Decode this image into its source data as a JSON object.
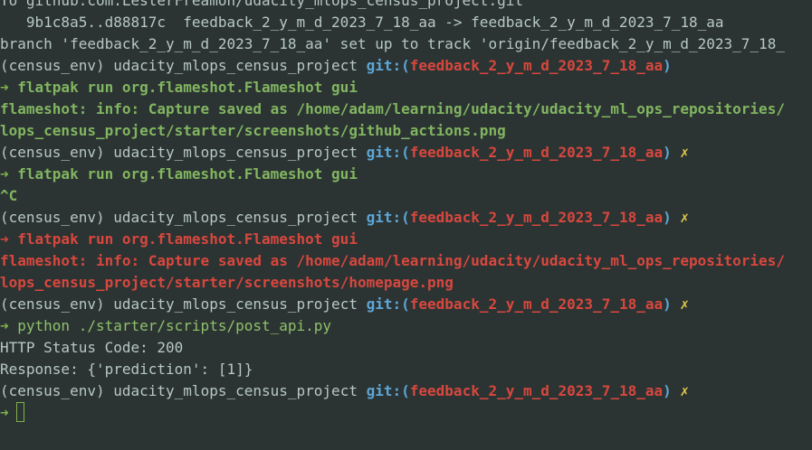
{
  "terminal": {
    "lines": [
      {
        "segments": [
          {
            "cls": "plain",
            "text": "To github.com:LesterFreamon/udacity_mlops_census_project.git"
          }
        ]
      },
      {
        "segments": [
          {
            "cls": "plain",
            "text": "   9b1c8a5..d88817c  feedback_2_y_m_d_2023_7_18_aa -> feedback_2_y_m_d_2023_7_18_aa"
          }
        ]
      },
      {
        "segments": [
          {
            "cls": "plain",
            "text": "branch 'feedback_2_y_m_d_2023_7_18_aa' set up to track 'origin/feedback_2_y_m_d_2023_7_18_"
          }
        ]
      },
      {
        "segments": [
          {
            "cls": "env",
            "text": "(census_env) "
          },
          {
            "cls": "dir",
            "text": "udacity_mlops_census_project "
          },
          {
            "cls": "git",
            "text": "git:("
          },
          {
            "cls": "br",
            "text": "feedback_2_y_m_d_2023_7_18_aa"
          },
          {
            "cls": "git",
            "text": ")"
          }
        ]
      },
      {
        "segments": [
          {
            "cls": "arrow-ok",
            "text": "➜ "
          },
          {
            "cls": "cmd-b",
            "text": "flatpak run org.flameshot.Flameshot gui"
          }
        ]
      },
      {
        "segments": [
          {
            "cls": "out-b",
            "text": "flameshot: info: Capture saved as /home/adam/learning/udacity/udacity_ml_ops_repositories/"
          }
        ]
      },
      {
        "segments": [
          {
            "cls": "out-b",
            "text": "lops_census_project/starter/screenshots/github_actions.png"
          }
        ]
      },
      {
        "segments": [
          {
            "cls": "env",
            "text": "(census_env) "
          },
          {
            "cls": "dir",
            "text": "udacity_mlops_census_project "
          },
          {
            "cls": "git",
            "text": "git:("
          },
          {
            "cls": "br",
            "text": "feedback_2_y_m_d_2023_7_18_aa"
          },
          {
            "cls": "git",
            "text": ") "
          },
          {
            "cls": "dirty",
            "text": "✗"
          }
        ]
      },
      {
        "segments": [
          {
            "cls": "arrow-ok",
            "text": "➜ "
          },
          {
            "cls": "cmd-b",
            "text": "flatpak run org.flameshot.Flameshot gui"
          }
        ]
      },
      {
        "segments": [
          {
            "cls": "out-b",
            "text": "^C"
          }
        ]
      },
      {
        "segments": [
          {
            "cls": "env",
            "text": "(census_env) "
          },
          {
            "cls": "dir",
            "text": "udacity_mlops_census_project "
          },
          {
            "cls": "git",
            "text": "git:("
          },
          {
            "cls": "br",
            "text": "feedback_2_y_m_d_2023_7_18_aa"
          },
          {
            "cls": "git",
            "text": ") "
          },
          {
            "cls": "dirty",
            "text": "✗"
          }
        ]
      },
      {
        "segments": [
          {
            "cls": "arrow-err",
            "text": "➜ "
          },
          {
            "cls": "err-b",
            "text": "flatpak run org.flameshot.Flameshot gui"
          }
        ]
      },
      {
        "segments": [
          {
            "cls": "err-b",
            "text": "flameshot: info: Capture saved as /home/adam/learning/udacity/udacity_ml_ops_repositories/"
          }
        ]
      },
      {
        "segments": [
          {
            "cls": "err-b",
            "text": "lops_census_project/starter/screenshots/homepage.png"
          }
        ]
      },
      {
        "segments": [
          {
            "cls": "env",
            "text": "(census_env) "
          },
          {
            "cls": "dir",
            "text": "udacity_mlops_census_project "
          },
          {
            "cls": "git",
            "text": "git:("
          },
          {
            "cls": "br",
            "text": "feedback_2_y_m_d_2023_7_18_aa"
          },
          {
            "cls": "git",
            "text": ") "
          },
          {
            "cls": "dirty",
            "text": "✗"
          }
        ]
      },
      {
        "segments": [
          {
            "cls": "arrow-ok",
            "text": "➜ "
          },
          {
            "cls": "cmd",
            "text": "python ./starter/scripts/post_api.py"
          }
        ]
      },
      {
        "segments": [
          {
            "cls": "plain",
            "text": "HTTP Status Code: 200"
          }
        ]
      },
      {
        "segments": [
          {
            "cls": "plain",
            "text": "Response: {'prediction': [1]}"
          }
        ]
      },
      {
        "segments": [
          {
            "cls": "env",
            "text": "(census_env) "
          },
          {
            "cls": "dir",
            "text": "udacity_mlops_census_project "
          },
          {
            "cls": "git",
            "text": "git:("
          },
          {
            "cls": "br",
            "text": "feedback_2_y_m_d_2023_7_18_aa"
          },
          {
            "cls": "git",
            "text": ") "
          },
          {
            "cls": "dirty",
            "text": "✗"
          }
        ]
      },
      {
        "segments": [
          {
            "cls": "arrow-ok",
            "text": "➜ "
          }
        ]
      }
    ]
  },
  "colors": {
    "background": "#2b3433",
    "git_label": "#5ea6d6",
    "branch": "#d8473e",
    "success": "#82b560",
    "error": "#d8473e",
    "dirty_mark": "#e2c84a",
    "plain_text": "#b8c8c4"
  }
}
